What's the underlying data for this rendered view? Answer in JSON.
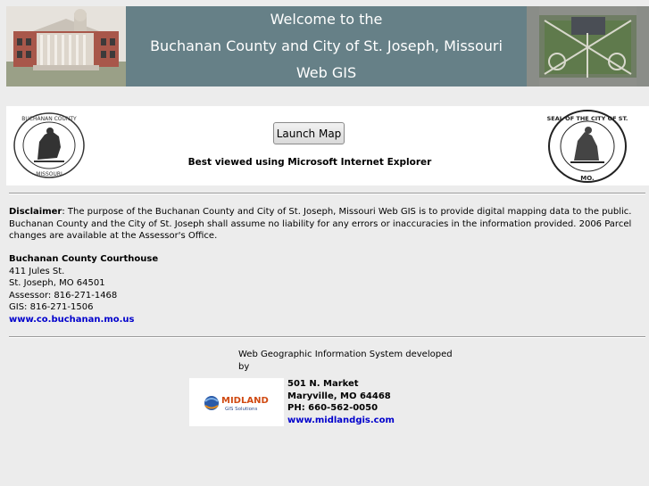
{
  "banner": {
    "line1": "Welcome to the",
    "line2": "Buchanan County and City of St. Joseph, Missouri",
    "line3": "Web GIS"
  },
  "seals": {
    "county_text": "BUCHANAN COUNTY MISSOURI",
    "city_text": "SEAL OF THE CITY OF ST. JOSEPH MO."
  },
  "launch": {
    "label": "Launch Map"
  },
  "best_viewed": "Best viewed using Microsoft Internet Explorer",
  "disclaimer": {
    "label": "Disclaimer",
    "text": ": The purpose of the Buchanan County and City of St. Joseph, Missouri Web GIS is to provide digital mapping data to the public.  Buchanan County and the City of St. Joseph shall assume no liability for any errors or inaccuracies in the information provided.  2006 Parcel changes are available at the Assessor's Office."
  },
  "courthouse": {
    "name": "Buchanan County Courthouse",
    "street": "411 Jules St.",
    "city": "St. Joseph, MO 64501",
    "assessor": "Assessor: 816-271-1468",
    "gis": "GIS: 816-271-1506",
    "website": "www.co.buchanan.mo.us"
  },
  "developer": {
    "developed_by": "Web Geographic Information System developed by",
    "logo_name": "MIDLAND",
    "logo_sub": "GIS Solutions",
    "street": "501 N. Market",
    "city": "Maryville, MO 64468",
    "phone": "PH: 660-562-0050",
    "website": "www.midlandgis.com"
  },
  "colors": {
    "banner_bg": "#668087",
    "page_bg": "#ececec",
    "link": "#0000cc"
  }
}
